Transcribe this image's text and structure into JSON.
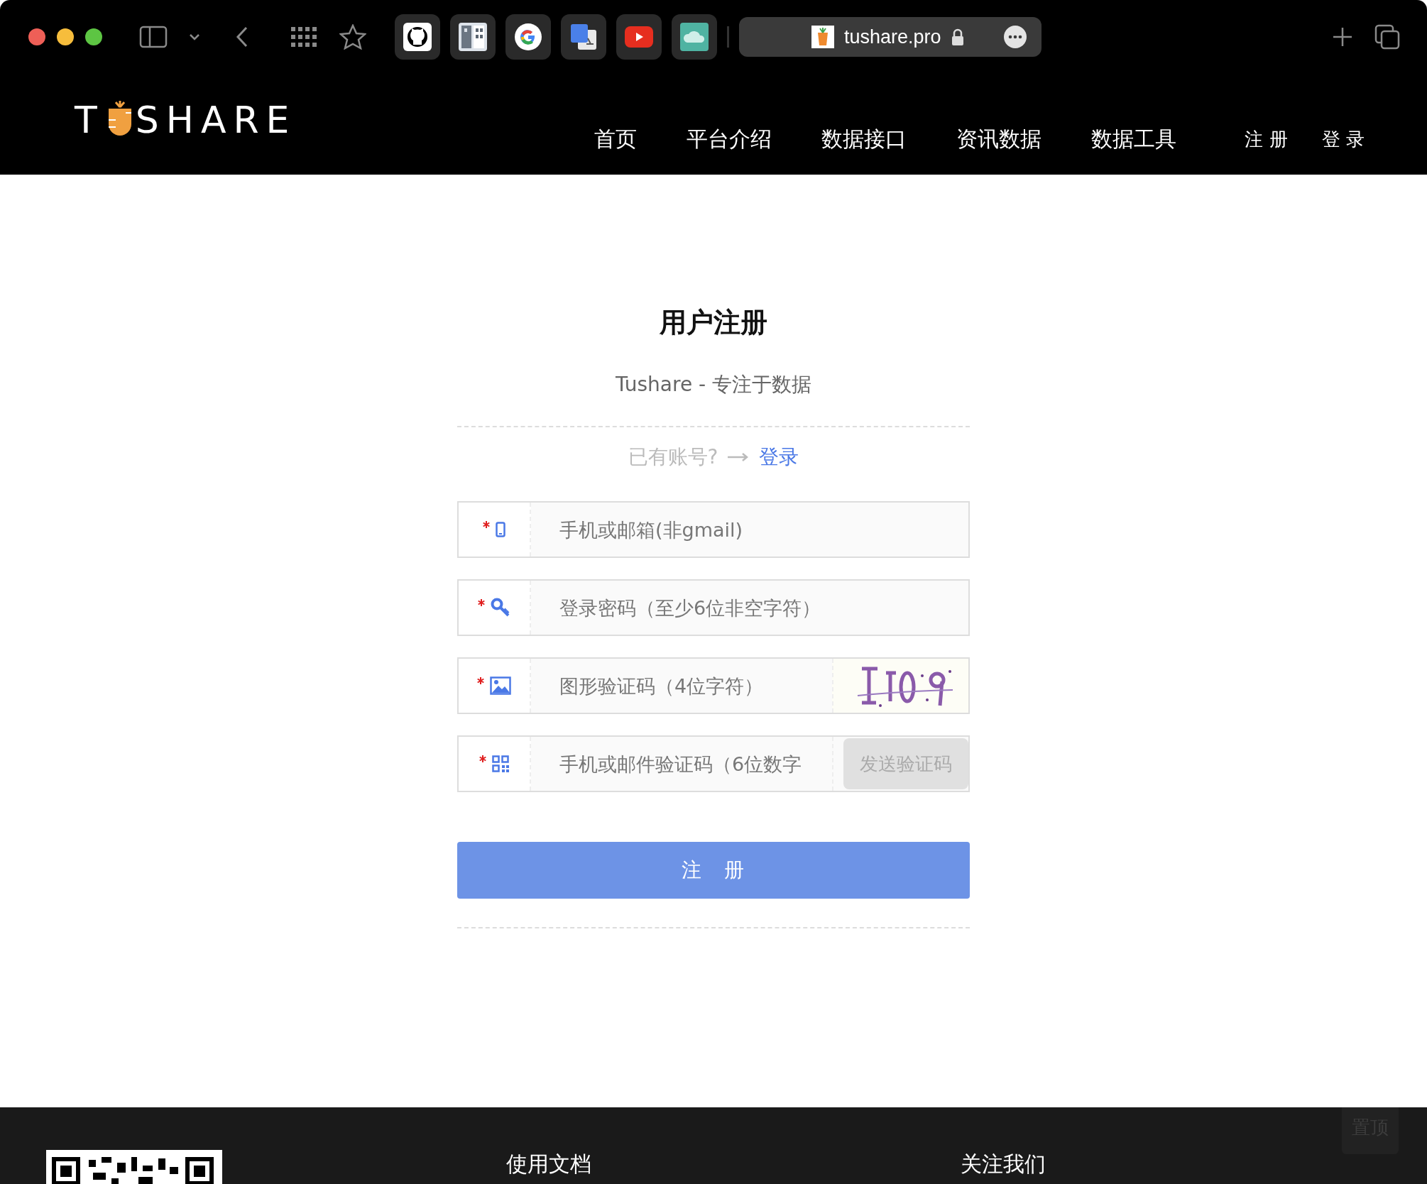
{
  "browser": {
    "address": "tushare.pro"
  },
  "site_header": {
    "logo": {
      "left": "T",
      "right": "SHARE"
    },
    "nav": [
      {
        "label": "首页"
      },
      {
        "label": "平台介绍"
      },
      {
        "label": "数据接口"
      },
      {
        "label": "资讯数据"
      },
      {
        "label": "数据工具"
      }
    ],
    "auth_links": [
      {
        "label": "注 册"
      },
      {
        "label": "登 录"
      }
    ]
  },
  "form": {
    "title": "用户注册",
    "subtitle": "Tushare - 专注于数据",
    "login_prompt": "已有账号?",
    "login_link": "登录",
    "fields": [
      {
        "kind": "phone",
        "required": true,
        "placeholder": "手机或邮箱(非gmail)"
      },
      {
        "kind": "password",
        "required": true,
        "placeholder": "登录密码（至少6位非空字符）"
      },
      {
        "kind": "captcha",
        "required": true,
        "placeholder": "图形验证码（4位字符）"
      },
      {
        "kind": "code",
        "required": true,
        "placeholder": "手机或邮件验证码（6位数字",
        "button": "发送验证码"
      }
    ],
    "submit": "注　册"
  },
  "footer": {
    "back_to_top": "置顶",
    "columns": [
      {
        "heading": "使用文档"
      },
      {
        "heading": "关注我们"
      }
    ]
  }
}
